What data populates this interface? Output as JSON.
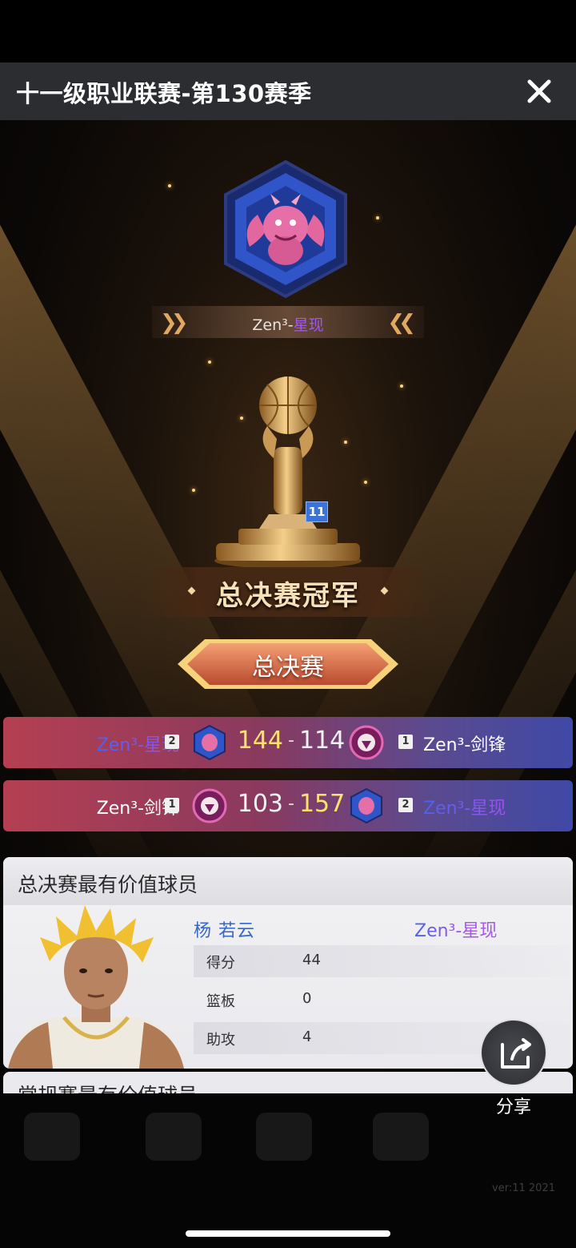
{
  "header": {
    "title": "十一级职业联赛-第130赛季"
  },
  "champion": {
    "team_prefix": "Zen³-",
    "team_suffix": "星现",
    "trophy_badge": "11",
    "title": "总决赛冠军"
  },
  "stage_button": {
    "label": "总决赛"
  },
  "games": [
    {
      "left_team": "Zen³-星现",
      "left_seed": "2",
      "left_score": "144",
      "right_score": "114",
      "right_seed": "1",
      "right_team": "Zen³-剑锋",
      "winner": "left"
    },
    {
      "left_team": "Zen³-剑锋",
      "left_seed": "1",
      "left_score": "103",
      "right_score": "157",
      "right_seed": "2",
      "right_team": "Zen³-星现",
      "winner": "right"
    }
  ],
  "finals_mvp": {
    "section_title": "总决赛最有价值球员",
    "player_name": "杨 若云",
    "team_prefix": "Zen³-",
    "team_suffix": "星现",
    "stats": [
      {
        "label": "得分",
        "value": "44"
      },
      {
        "label": "篮板",
        "value": "0"
      },
      {
        "label": "助攻",
        "value": "4"
      }
    ]
  },
  "regular_mvp": {
    "section_title": "常规赛最有价值球员"
  },
  "share": {
    "label": "分享"
  },
  "footer": {
    "version": "ver:11  2021"
  },
  "colors": {
    "accent_purple": "#a457f0",
    "accent_blue": "#3566c9",
    "win_score": "#ffe36b",
    "topbar": "#2b2d31"
  },
  "icons": {
    "close": "close-icon",
    "share": "share-icon",
    "team_logo_xingxian": "dragon-logo-icon",
    "team_logo_jianfeng": "warrior-logo-icon"
  }
}
